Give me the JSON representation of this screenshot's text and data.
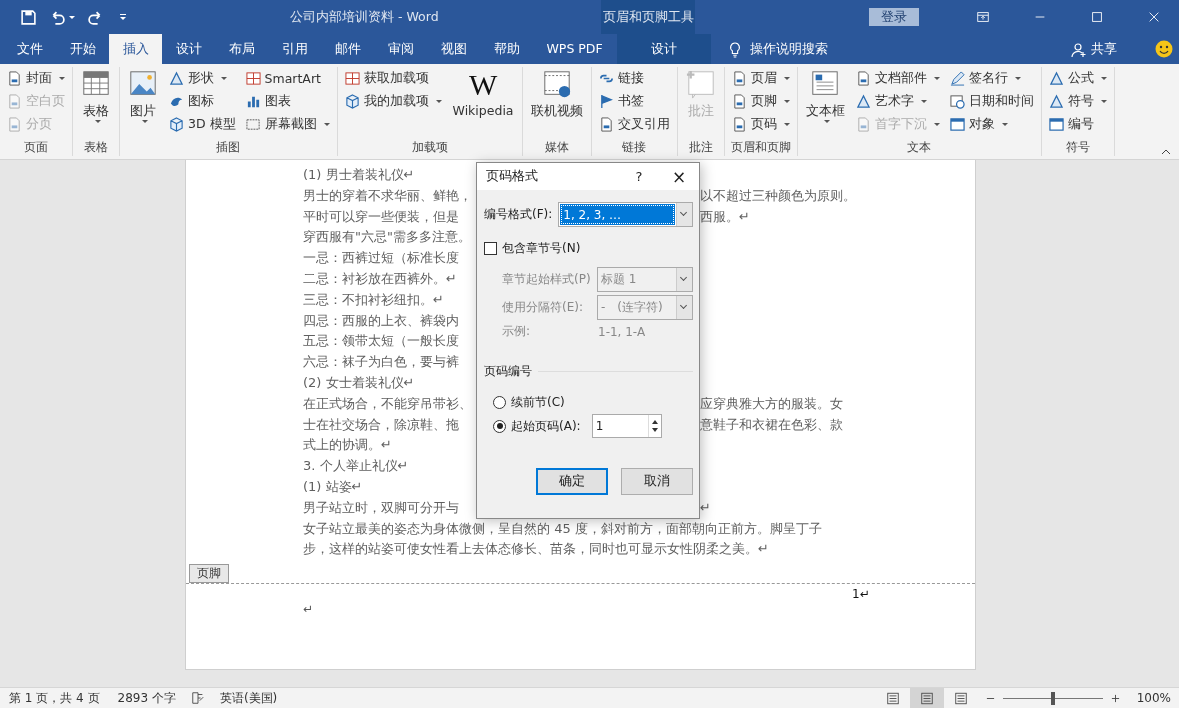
{
  "window": {
    "title": "公司内部培训资料  -  Word",
    "context_title": "页眉和页脚工具",
    "signin": "登录"
  },
  "tabs": [
    {
      "label": "文件",
      "selected": false
    },
    {
      "label": "开始",
      "selected": false
    },
    {
      "label": "插入",
      "selected": true
    },
    {
      "label": "设计",
      "selected": false
    },
    {
      "label": "布局",
      "selected": false
    },
    {
      "label": "引用",
      "selected": false
    },
    {
      "label": "邮件",
      "selected": false
    },
    {
      "label": "审阅",
      "selected": false
    },
    {
      "label": "视图",
      "selected": false
    },
    {
      "label": "帮助",
      "selected": false
    },
    {
      "label": "WPS PDF",
      "selected": false
    }
  ],
  "context_tab": {
    "label": "设计",
    "selected": false
  },
  "tell_me": "操作说明搜索",
  "share": "共享",
  "ribbon": {
    "groups": [
      {
        "label": "页面",
        "columns": [
          [
            {
              "kind": "small",
              "label": "封面",
              "dropdown": true,
              "disabled": false
            },
            {
              "kind": "small",
              "label": "空白页",
              "dropdown": false,
              "disabled": true
            },
            {
              "kind": "small",
              "label": "分页",
              "dropdown": false,
              "disabled": true
            }
          ]
        ]
      },
      {
        "label": "表格",
        "columns": [
          [
            {
              "kind": "large",
              "label": "表格",
              "dropdown": true,
              "disabled": false
            }
          ]
        ]
      },
      {
        "label": "插图",
        "columns": [
          [
            {
              "kind": "large",
              "label": "图片",
              "dropdown": true,
              "disabled": false
            }
          ],
          [
            {
              "kind": "small",
              "label": "形状",
              "dropdown": true,
              "disabled": false
            },
            {
              "kind": "small",
              "label": "图标",
              "dropdown": false,
              "disabled": false
            },
            {
              "kind": "small",
              "label": "3D 模型",
              "dropdown": false,
              "disabled": false
            }
          ],
          [
            {
              "kind": "small",
              "label": "SmartArt",
              "dropdown": false,
              "disabled": false
            },
            {
              "kind": "small",
              "label": "图表",
              "dropdown": false,
              "disabled": false
            },
            {
              "kind": "small",
              "label": "屏幕截图",
              "dropdown": true,
              "disabled": false
            }
          ]
        ]
      },
      {
        "label": "加载项",
        "columns": [
          [
            {
              "kind": "small",
              "label": "获取加载项",
              "dropdown": false,
              "disabled": false
            },
            {
              "kind": "small",
              "label": "我的加载项",
              "dropdown": true,
              "disabled": false
            }
          ],
          [
            {
              "kind": "large",
              "label": "Wikipedia",
              "glyph": "W",
              "dropdown": false,
              "disabled": false
            }
          ]
        ]
      },
      {
        "label": "媒体",
        "columns": [
          [
            {
              "kind": "large",
              "label": "联机视频",
              "dropdown": false,
              "disabled": false
            }
          ]
        ]
      },
      {
        "label": "链接",
        "columns": [
          [
            {
              "kind": "small",
              "label": "链接",
              "dropdown": false,
              "disabled": false
            },
            {
              "kind": "small",
              "label": "书签",
              "dropdown": false,
              "disabled": false
            },
            {
              "kind": "small",
              "label": "交叉引用",
              "dropdown": false,
              "disabled": false
            }
          ]
        ]
      },
      {
        "label": "批注",
        "columns": [
          [
            {
              "kind": "large",
              "label": "批注",
              "dropdown": false,
              "disabled": true
            }
          ]
        ]
      },
      {
        "label": "页眉和页脚",
        "columns": [
          [
            {
              "kind": "small",
              "label": "页眉",
              "dropdown": true,
              "disabled": false
            },
            {
              "kind": "small",
              "label": "页脚",
              "dropdown": true,
              "disabled": false
            },
            {
              "kind": "small",
              "label": "页码",
              "dropdown": true,
              "disabled": false
            }
          ]
        ]
      },
      {
        "label": "文本",
        "columns": [
          [
            {
              "kind": "large",
              "label": "文本框",
              "dropdown": true,
              "disabled": false
            }
          ],
          [
            {
              "kind": "small",
              "label": "文档部件",
              "dropdown": true,
              "disabled": false
            },
            {
              "kind": "small",
              "label": "艺术字",
              "dropdown": true,
              "disabled": false
            },
            {
              "kind": "small",
              "label": "首字下沉",
              "dropdown": true,
              "disabled": true
            }
          ],
          [
            {
              "kind": "small",
              "label": "签名行",
              "dropdown": true,
              "disabled": false
            },
            {
              "kind": "small",
              "label": "日期和时间",
              "dropdown": false,
              "disabled": false
            },
            {
              "kind": "small",
              "label": "对象",
              "dropdown": true,
              "disabled": false
            }
          ]
        ]
      },
      {
        "label": "符号",
        "columns": [
          [
            {
              "kind": "small",
              "label": "公式",
              "dropdown": true,
              "disabled": false
            },
            {
              "kind": "small",
              "label": "符号",
              "dropdown": true,
              "disabled": false
            },
            {
              "kind": "small",
              "label": "编号",
              "dropdown": false,
              "disabled": false
            }
          ]
        ]
      }
    ]
  },
  "document": {
    "lines": [
      {
        "left": "(1) 男士着装礼仪↵"
      },
      {
        "left": "男士的穿着不求华丽、鲜艳，",
        "right": "以不超过三种颜色为原则。"
      },
      {
        "left": "平时可以穿一些便装，但是",
        "right": "西服。↵"
      },
      {
        "left": "穿西服有\"六忌\"需多多注意。"
      },
      {
        "left": "一忌：西裤过短（标准长度"
      },
      {
        "left": "二忌：衬衫放在西裤外。↵"
      },
      {
        "left": "三忌：不扣衬衫纽扣。↵"
      },
      {
        "left": "四忌：西服的上衣、裤袋内"
      },
      {
        "left": "五忌：领带太短（一般长度"
      },
      {
        "left": "六忌：袜子为白色，要与裤"
      },
      {
        "left": "(2) 女士着装礼仪↵"
      },
      {
        "left": "在正式场合，不能穿吊带衫、",
        "right": "应穿典雅大方的服装。女"
      },
      {
        "left": "士在社交场合，除凉鞋、拖",
        "right": "意鞋子和衣裙在色彩、款"
      },
      {
        "left": "式上的协调。↵"
      },
      {
        "left": "3. 个人举止礼仪↵"
      },
      {
        "left": "(1) 站姿↵"
      },
      {
        "left": "男子站立时，双脚可分开与",
        "right": "↵"
      },
      {
        "full": "女子站立最美的姿态为身体微侧，呈自然的 45 度，斜对前方，面部朝向正前方。脚呈丁子"
      },
      {
        "full": "步，这样的站姿可使女性看上去体态修长、苗条，同时也可显示女性阴柔之美。↵"
      }
    ],
    "footer_tag": "页脚",
    "footer_left": "↵",
    "footer_right": "1↵"
  },
  "dialog": {
    "title": "页码格式",
    "help": "?",
    "close": "×",
    "number_format": {
      "label": "编号格式(F):",
      "value": "1, 2, 3, …"
    },
    "include_chapter": {
      "label": "包含章节号(N)",
      "checked": false
    },
    "chapter_style": {
      "label": "章节起始样式(P)",
      "value": "标题 1",
      "disabled": true
    },
    "separator": {
      "label": "使用分隔符(E):",
      "value": "-　(连字符)",
      "disabled": true
    },
    "example": {
      "label": "示例:",
      "value": "1-1, 1-A",
      "disabled": true
    },
    "numbering": {
      "title": "页码编号",
      "options": [
        {
          "label": "续前节(C)",
          "selected": false
        },
        {
          "label": "起始页码(A):",
          "selected": true
        }
      ],
      "start_value": "1"
    },
    "buttons": [
      {
        "label": "确定",
        "default": true
      },
      {
        "label": "取消",
        "default": false
      }
    ]
  },
  "status_bar": {
    "page": "第 1 页，共 4 页",
    "words": "2893 个字",
    "language": "英语(美国)",
    "views": [
      {
        "selected": false
      },
      {
        "selected": true
      },
      {
        "selected": false
      }
    ],
    "zoom": {
      "level": 0.5,
      "reading": "100%"
    }
  }
}
